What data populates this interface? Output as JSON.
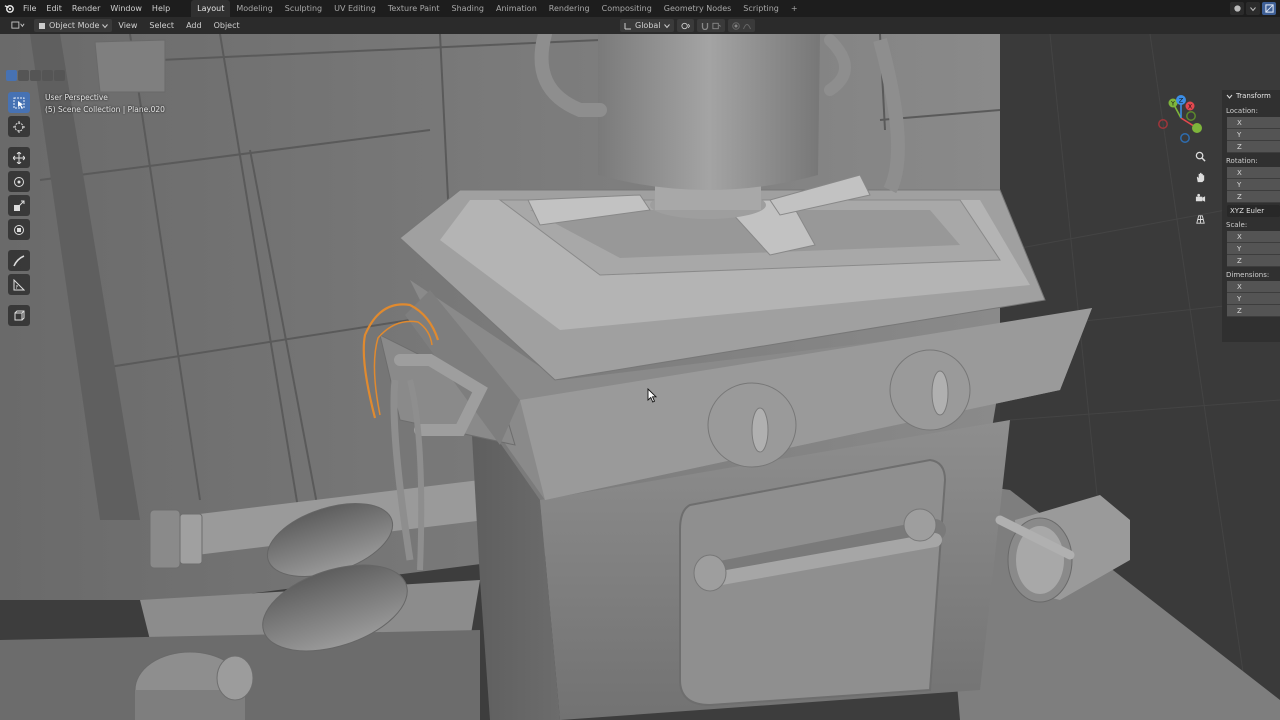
{
  "topbar": {
    "logo_icon": "blender-logo-icon",
    "menus": [
      "File",
      "Edit",
      "Render",
      "Window",
      "Help"
    ],
    "workspace_tabs": [
      "Layout",
      "Modeling",
      "Sculpting",
      "UV Editing",
      "Texture Paint",
      "Shading",
      "Animation",
      "Rendering",
      "Compositing",
      "Geometry Nodes",
      "Scripting"
    ],
    "active_tab": "Layout",
    "add_tab": "+"
  },
  "header": {
    "mode": "Object Mode",
    "menus": [
      "View",
      "Select",
      "Add",
      "Object"
    ],
    "transform_orientation": "Global"
  },
  "viewport": {
    "view_name": "User Perspective",
    "collection_info": "(5) Scene Collection | Plane.020"
  },
  "gizmo": {
    "x_label": "X",
    "y_label": "Y",
    "z_label": "Z",
    "colors": {
      "x": "#e3484f",
      "y": "#7eb53b",
      "z": "#3c8ee6"
    }
  },
  "npanel": {
    "section": "Transform",
    "location_label": "Location:",
    "rotation_label": "Rotation:",
    "rotation_mode": "XYZ Euler",
    "scale_label": "Scale:",
    "dimensions_label": "Dimensions:",
    "axes": [
      "X",
      "Y",
      "Z"
    ]
  },
  "colors": {
    "accent": "#4772b3",
    "selection": "#e08a2f",
    "background": "#3d3d3d"
  }
}
